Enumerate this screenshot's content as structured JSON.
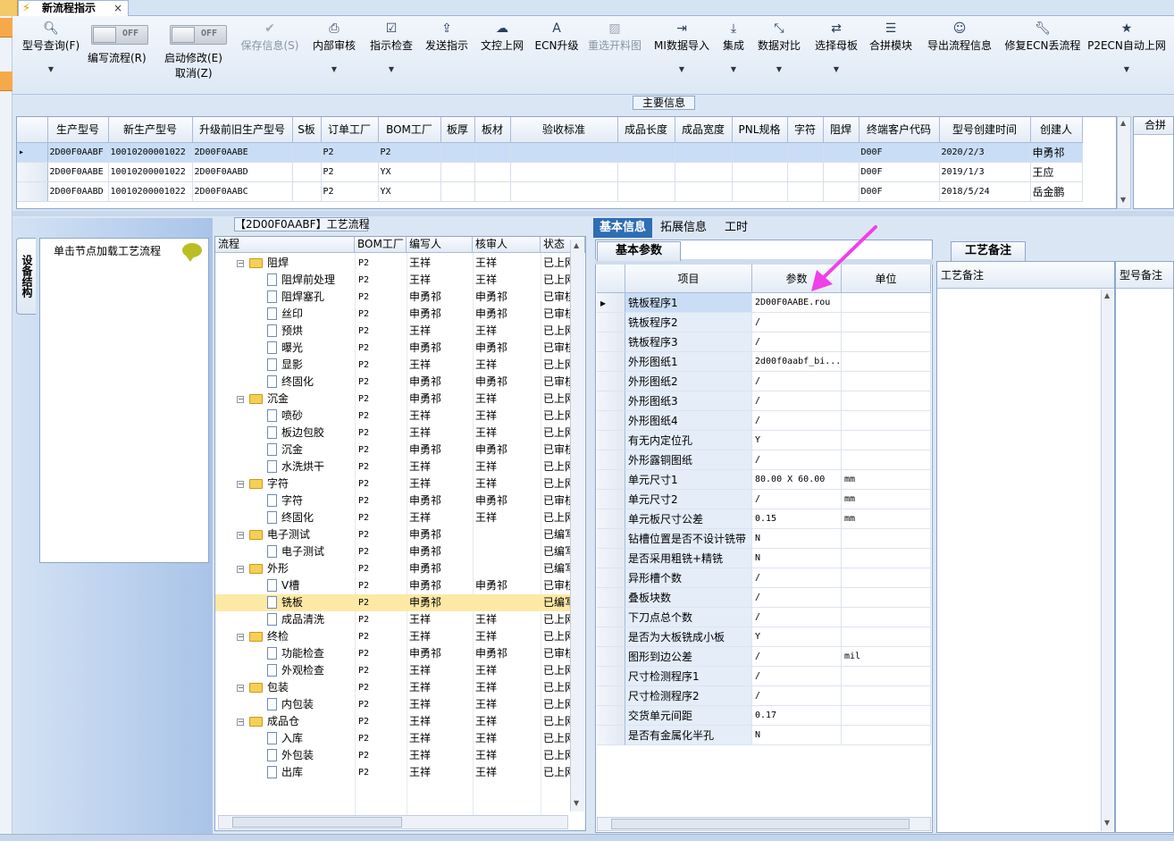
{
  "window": {
    "tab_title": "新流程指示",
    "close": "×"
  },
  "ribbon": {
    "model_query": "型号查询(F)",
    "edit_flow": "编写流程(R)",
    "start_modify": "启动修改(E)",
    "cancel": "取消(Z)",
    "toggle_off": "OFF",
    "save_info": "保存信息(S)",
    "internal_review": "内部审核",
    "instruction_check": "指示检查",
    "send_instruction": "发送指示",
    "file_upload": "文控上网",
    "ecn_upgrade": "ECN升级",
    "reselect_cut": "重选开料图",
    "mi_import": "MI数据导入",
    "integrate": "集成",
    "data_compare": "数据对比",
    "select_master": "选择母板",
    "merge_module": "合拼模块",
    "export_flow": "导出流程信息",
    "fix_ecn": "修复ECN丢流程",
    "p2ecn_auto": "P2ECN自动上网"
  },
  "main_info": {
    "title": "主要信息",
    "side_group": "合拼",
    "columns": [
      "生产型号",
      "新生产型号",
      "升级前旧生产型号",
      "S板",
      "订单工厂",
      "BOM工厂",
      "板厚",
      "板材",
      "验收标准",
      "成品长度",
      "成品宽度",
      "PNL规格",
      "字符",
      "阻焊",
      "终端客户代码",
      "型号创建时间",
      "创建人"
    ],
    "rows": [
      [
        "2D00F0AABF",
        "10010200001022",
        "2D00F0AABE",
        "",
        "P2",
        "P2",
        "",
        "",
        "",
        "",
        "",
        "",
        "",
        "",
        "D00F",
        "2020/2/3",
        "申勇祁"
      ],
      [
        "2D00F0AABE",
        "10010200001022",
        "2D00F0AABD",
        "",
        "P2",
        "YX",
        "",
        "",
        "",
        "",
        "",
        "",
        "",
        "",
        "D00F",
        "2019/1/3",
        "王应"
      ],
      [
        "2D00F0AABD",
        "10010200001022",
        "2D00F0AABC",
        "",
        "P2",
        "YX",
        "",
        "",
        "",
        "",
        "",
        "",
        "",
        "",
        "D00F",
        "2018/5/24",
        "岳金鹏"
      ]
    ]
  },
  "device": {
    "tab": "设备结构",
    "hint": "单击节点加载工艺流程"
  },
  "flow": {
    "title": "【2D00F0AABF】工艺流程",
    "columns": [
      "流程",
      "BOM工厂",
      "编写人",
      "核审人",
      "状态"
    ],
    "rows": [
      {
        "lvl": 0,
        "name": "阻焊",
        "bom": "P2",
        "writer": "王祥",
        "reviewer": "王祥",
        "status": "已上网"
      },
      {
        "lvl": 1,
        "name": "阻焊前处理",
        "bom": "P2",
        "writer": "王祥",
        "reviewer": "王祥",
        "status": "已上网"
      },
      {
        "lvl": 1,
        "name": "阻焊塞孔",
        "bom": "P2",
        "writer": "申勇祁",
        "reviewer": "申勇祁",
        "status": "已审核"
      },
      {
        "lvl": 1,
        "name": "丝印",
        "bom": "P2",
        "writer": "申勇祁",
        "reviewer": "申勇祁",
        "status": "已审核"
      },
      {
        "lvl": 1,
        "name": "预烘",
        "bom": "P2",
        "writer": "王祥",
        "reviewer": "王祥",
        "status": "已上网"
      },
      {
        "lvl": 1,
        "name": "曝光",
        "bom": "P2",
        "writer": "申勇祁",
        "reviewer": "申勇祁",
        "status": "已审核"
      },
      {
        "lvl": 1,
        "name": "显影",
        "bom": "P2",
        "writer": "王祥",
        "reviewer": "王祥",
        "status": "已上网"
      },
      {
        "lvl": 1,
        "name": "终固化",
        "bom": "P2",
        "writer": "申勇祁",
        "reviewer": "申勇祁",
        "status": "已审核"
      },
      {
        "lvl": 0,
        "name": "沉金",
        "bom": "P2",
        "writer": "申勇祁",
        "reviewer": "王祥",
        "status": "已上网"
      },
      {
        "lvl": 1,
        "name": "喷砂",
        "bom": "P2",
        "writer": "王祥",
        "reviewer": "王祥",
        "status": "已上网"
      },
      {
        "lvl": 1,
        "name": "板边包胶",
        "bom": "P2",
        "writer": "王祥",
        "reviewer": "王祥",
        "status": "已上网"
      },
      {
        "lvl": 1,
        "name": "沉金",
        "bom": "P2",
        "writer": "申勇祁",
        "reviewer": "申勇祁",
        "status": "已审核"
      },
      {
        "lvl": 1,
        "name": "水洗烘干",
        "bom": "P2",
        "writer": "王祥",
        "reviewer": "王祥",
        "status": "已上网"
      },
      {
        "lvl": 0,
        "name": "字符",
        "bom": "P2",
        "writer": "王祥",
        "reviewer": "王祥",
        "status": "已上网"
      },
      {
        "lvl": 1,
        "name": "字符",
        "bom": "P2",
        "writer": "申勇祁",
        "reviewer": "申勇祁",
        "status": "已审核"
      },
      {
        "lvl": 1,
        "name": "终固化",
        "bom": "P2",
        "writer": "王祥",
        "reviewer": "王祥",
        "status": "已上网"
      },
      {
        "lvl": 0,
        "name": "电子测试",
        "bom": "P2",
        "writer": "申勇祁",
        "reviewer": "",
        "status": "已编写"
      },
      {
        "lvl": 1,
        "name": "电子测试",
        "bom": "P2",
        "writer": "申勇祁",
        "reviewer": "",
        "status": "已编写"
      },
      {
        "lvl": 0,
        "name": "外形",
        "bom": "P2",
        "writer": "申勇祁",
        "reviewer": "",
        "status": "已编写"
      },
      {
        "lvl": 1,
        "name": "V槽",
        "bom": "P2",
        "writer": "申勇祁",
        "reviewer": "申勇祁",
        "status": "已审核"
      },
      {
        "lvl": 1,
        "name": "铣板",
        "bom": "P2",
        "writer": "申勇祁",
        "reviewer": "",
        "status": "已编写",
        "sel": true
      },
      {
        "lvl": 1,
        "name": "成品清洗",
        "bom": "P2",
        "writer": "王祥",
        "reviewer": "王祥",
        "status": "已上网"
      },
      {
        "lvl": 0,
        "name": "终检",
        "bom": "P2",
        "writer": "王祥",
        "reviewer": "王祥",
        "status": "已上网"
      },
      {
        "lvl": 1,
        "name": "功能检查",
        "bom": "P2",
        "writer": "申勇祁",
        "reviewer": "申勇祁",
        "status": "已审核"
      },
      {
        "lvl": 1,
        "name": "外观检查",
        "bom": "P2",
        "writer": "王祥",
        "reviewer": "王祥",
        "status": "已上网"
      },
      {
        "lvl": 0,
        "name": "包装",
        "bom": "P2",
        "writer": "王祥",
        "reviewer": "王祥",
        "status": "已上网"
      },
      {
        "lvl": 1,
        "name": "内包装",
        "bom": "P2",
        "writer": "王祥",
        "reviewer": "王祥",
        "status": "已上网"
      },
      {
        "lvl": 0,
        "name": "成品仓",
        "bom": "P2",
        "writer": "王祥",
        "reviewer": "王祥",
        "status": "已上网"
      },
      {
        "lvl": 1,
        "name": "入库",
        "bom": "P2",
        "writer": "王祥",
        "reviewer": "王祥",
        "status": "已上网"
      },
      {
        "lvl": 1,
        "name": "外包装",
        "bom": "P2",
        "writer": "王祥",
        "reviewer": "王祥",
        "status": "已上网"
      },
      {
        "lvl": 1,
        "name": "出库",
        "bom": "P2",
        "writer": "王祥",
        "reviewer": "王祥",
        "status": "已上网"
      }
    ]
  },
  "right_tabs": [
    "基本信息",
    "拓展信息",
    "工时"
  ],
  "basic": {
    "tab": "基本参数",
    "columns": [
      "项目",
      "参数",
      "单位"
    ],
    "rows": [
      [
        "铣板程序1",
        "2D00F0AABE.rou",
        ""
      ],
      [
        "铣板程序2",
        "/",
        ""
      ],
      [
        "铣板程序3",
        "/",
        ""
      ],
      [
        "外形图纸1",
        "2d00f0aabf_bi...",
        ""
      ],
      [
        "外形图纸2",
        "/",
        ""
      ],
      [
        "外形图纸3",
        "/",
        ""
      ],
      [
        "外形图纸4",
        "/",
        ""
      ],
      [
        "有无内定位孔",
        "Y",
        ""
      ],
      [
        "外形露铜图纸",
        "/",
        ""
      ],
      [
        "单元尺寸1",
        "80.00 X 60.00",
        "mm"
      ],
      [
        "单元尺寸2",
        "/",
        "mm"
      ],
      [
        "单元板尺寸公差",
        "0.15",
        "mm"
      ],
      [
        "钻槽位置是否不设计铣带",
        "N",
        ""
      ],
      [
        "是否采用粗铣+精铣",
        "N",
        ""
      ],
      [
        "异形槽个数",
        "/",
        ""
      ],
      [
        "叠板块数",
        "/",
        ""
      ],
      [
        "下刀点总个数",
        "/",
        ""
      ],
      [
        "是否为大板铣成小板",
        "Y",
        ""
      ],
      [
        "图形到边公差",
        "/",
        "mil"
      ],
      [
        "尺寸检测程序1",
        "/",
        ""
      ],
      [
        "尺寸检测程序2",
        "/",
        ""
      ],
      [
        "交货单元间距",
        "0.17",
        ""
      ],
      [
        "是否有金属化半孔",
        "N",
        ""
      ]
    ]
  },
  "remarks": {
    "tab": "工艺备注",
    "col1": "工艺备注",
    "col2": "型号备注"
  },
  "colors": {
    "accent": "#2f6db4",
    "selection": "#c9ddf6",
    "tree_selection": "#fde9a6",
    "annotation_arrow": "#f040e8"
  }
}
